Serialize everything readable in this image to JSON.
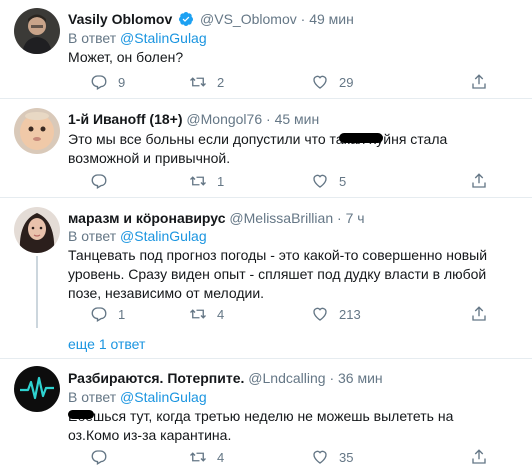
{
  "tweets": [
    {
      "name": "Vasily Oblomov",
      "handle": "@VS_Oblomov",
      "time": "49 мин",
      "reply_prefix": "В ответ",
      "reply_to": "@StalinGulag",
      "text": "Может, он болен?",
      "replies": "9",
      "retweets": "2",
      "likes": "29"
    },
    {
      "name": "1-й Иванoff (18+)",
      "handle": "@Mongol76",
      "time": "45 мин",
      "text": "Это мы все больны если допустили что такая хуйня стала возможной и привычной.",
      "replies": "",
      "retweets": "1",
      "likes": "5"
    },
    {
      "name": "маразм и кöронавирус",
      "handle": "@MelissaBrillian",
      "time": "7 ч",
      "reply_prefix": "В ответ",
      "reply_to": "@StalinGulag",
      "text": "Танцевать под прогноз погоды - это какой-то совершенно новый уровень. Сразу виден опыт - спляшет под дудку власти в любой позе, независимо от мелодии.",
      "replies": "1",
      "retweets": "4",
      "likes": "213"
    },
    {
      "name": "Разбираются. Потерпите.",
      "handle": "@Lndcalling",
      "time": "36 мин",
      "reply_prefix": "В ответ",
      "reply_to": "@StalinGulag",
      "text": "Ебешься тут, когда третью неделю не можешь вылететь на оз.Комо из-за карантина.",
      "replies": "",
      "retweets": "4",
      "likes": "35"
    }
  ],
  "more_replies": "еще 1 ответ",
  "separator": "·",
  "colors": {
    "accent": "#1b95e0",
    "muted": "#657786",
    "divider": "#e6ecf0"
  },
  "icons": [
    "verified-badge-icon",
    "reply-icon",
    "retweet-icon",
    "like-icon",
    "share-icon"
  ]
}
